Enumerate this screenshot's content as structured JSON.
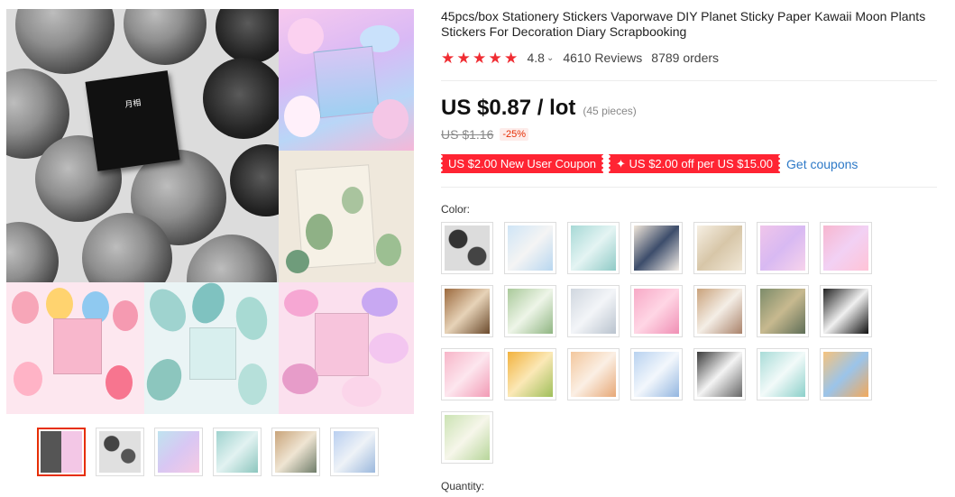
{
  "product": {
    "title": "45pcs/box Stationery Stickers Vaporwave DIY Planet Sticky Paper Kawaii Moon Plants Stickers For Decoration Diary Scrapbooking",
    "rating": "4.8",
    "rating_stars": 5,
    "reviews": "4610 Reviews",
    "orders": "8789 orders"
  },
  "price": {
    "current": "US $0.87 / lot",
    "pieces": "(45 pieces)",
    "original": "US $1.16",
    "discount": "-25%"
  },
  "coupons": {
    "new_user": "US $2.00 New User Coupon",
    "store": "✦ US $2.00 off per US $15.00",
    "get_label": "Get coupons"
  },
  "variants": {
    "color_label": "Color:",
    "swatch_count": 22,
    "quantity_label": "Quantity:"
  },
  "gallery": {
    "main_box_text": "月相",
    "thumbnail_count": 6,
    "selected_thumbnail": 1
  },
  "colors": {
    "accent_red": "#ff2433",
    "star_red": "#f02c32",
    "link_blue": "#2d79c7"
  },
  "icons": {
    "star": "star-icon",
    "chevron": "chevron-down-icon"
  }
}
